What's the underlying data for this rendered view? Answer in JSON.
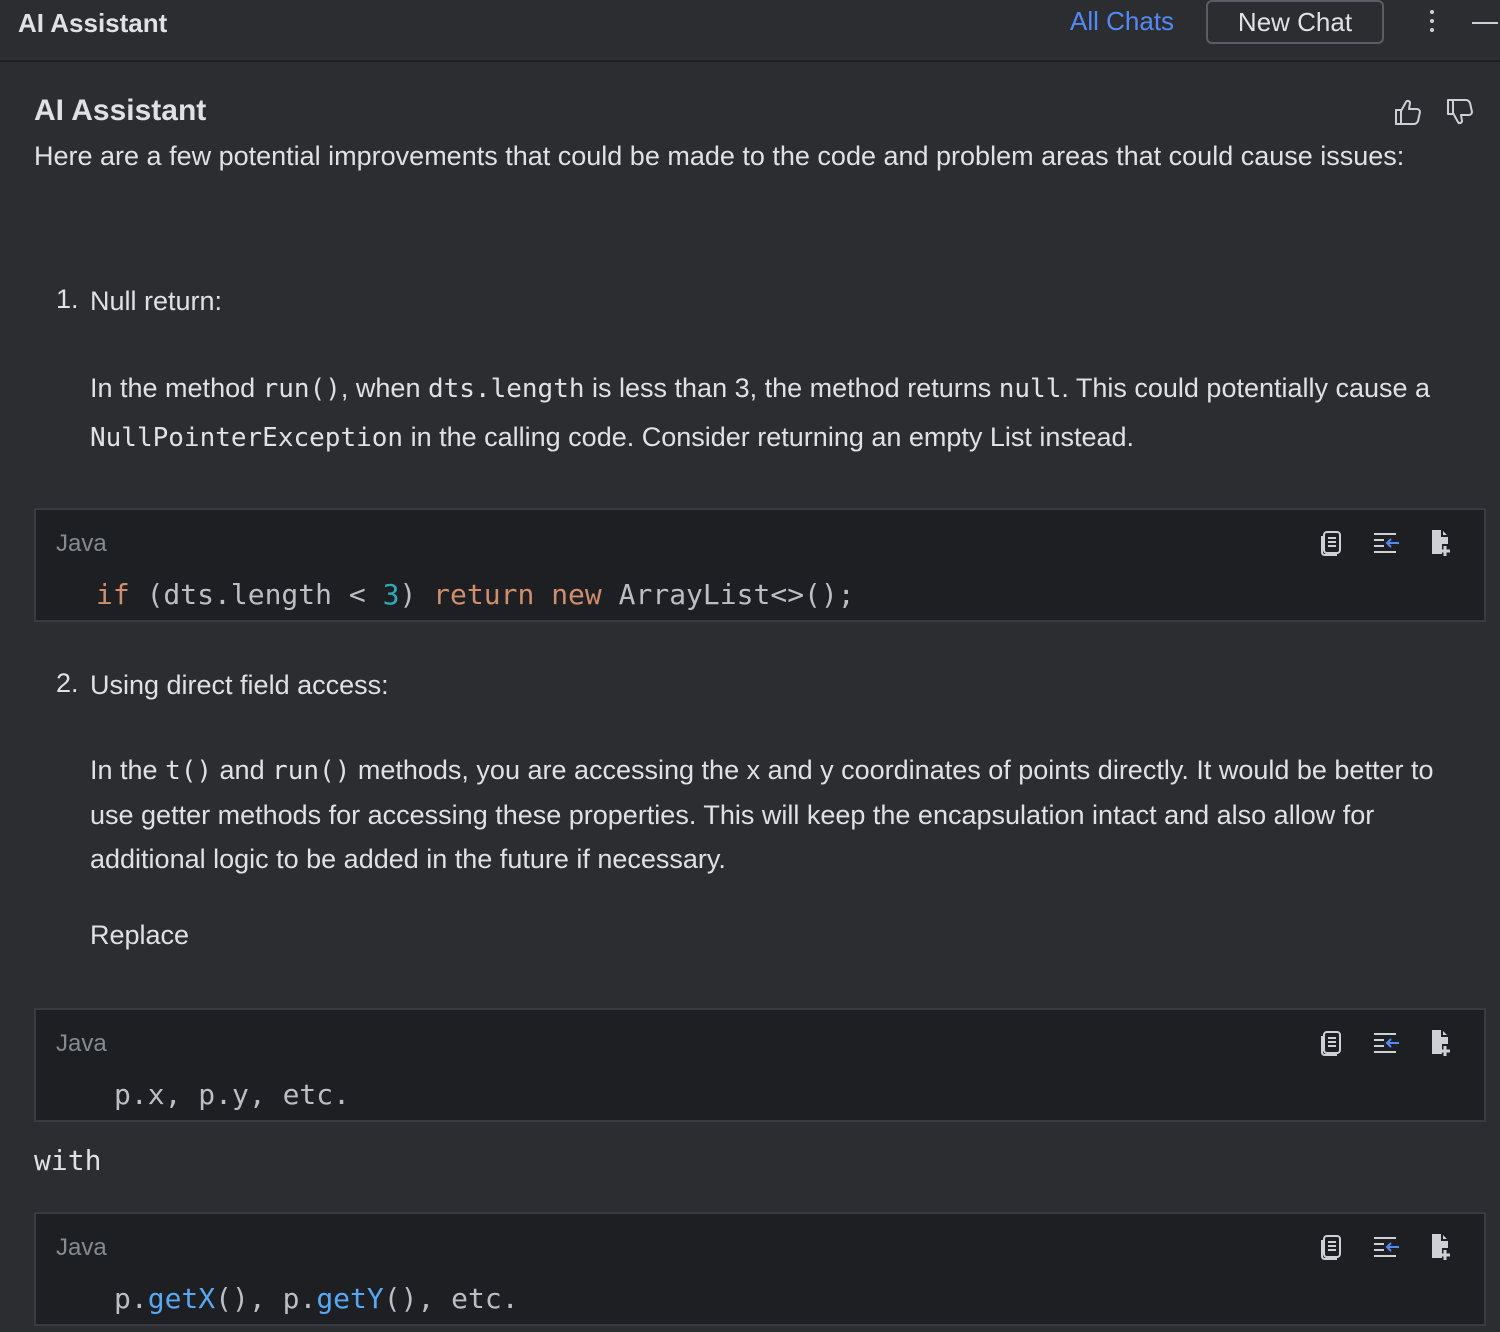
{
  "header": {
    "title": "AI Assistant",
    "all_chats": "All Chats",
    "new_chat": "New Chat"
  },
  "message": {
    "author": "AI Assistant",
    "intro": "Here are a few potential improvements that could be made to the code and problem areas that could cause issues:",
    "items": [
      {
        "number": "1.",
        "title": "Null return:",
        "body": {
          "t1": "In the method ",
          "c1": "run()",
          "t2": ", when ",
          "c2": "dts.length",
          "t3": " is less than 3, the method returns ",
          "c3": "null",
          "t4": ". This could potentially cause a ",
          "c4": "NullPointerException",
          "t5": " in the calling code. Consider returning an empty List instead."
        }
      },
      {
        "number": "2.",
        "title": "Using direct field access:",
        "body": {
          "t1": "In the ",
          "c1": "t()",
          "t2": " and ",
          "c2": "run()",
          "t3": " methods, you are accessing the x and y coordinates of points directly. It would be better to use getter methods for accessing these properties. This will keep the encapsulation intact and also allow for additional logic to be added in the future if necessary."
        },
        "replace_label": "Replace"
      }
    ],
    "with_label": "with"
  },
  "code_blocks": [
    {
      "language": "Java",
      "tokens": {
        "if": "if",
        "cond_a": " (dts.length < ",
        "num": "3",
        "cond_b": ") ",
        "ret": "return",
        "sp": " ",
        "new": "new",
        "rest": " ArrayList<>();"
      }
    },
    {
      "language": "Java",
      "code": "p.x, p.y, etc."
    },
    {
      "language": "Java",
      "tokens": {
        "p1": "p.",
        "m1": "getX",
        "mid": "(), p.",
        "m2": "getY",
        "end": "(), etc."
      }
    }
  ],
  "icons": {
    "thumbs_up": "thumbs-up-icon",
    "thumbs_down": "thumbs-down-icon",
    "copy": "copy-icon",
    "insert_caret": "insert-at-caret-icon",
    "new_file": "new-file-icon",
    "more": "more-vertical-icon",
    "minimize": "minimize-icon"
  },
  "colors": {
    "background": "#2b2d30",
    "code_background": "#1e1f22",
    "link": "#548af7",
    "keyword": "#cf8e6d",
    "number": "#2aacb8",
    "method": "#56a8f5"
  }
}
